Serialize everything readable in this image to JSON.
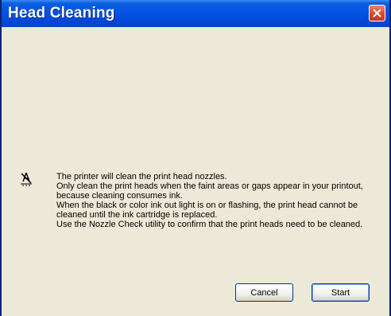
{
  "window": {
    "title": "Head Cleaning"
  },
  "message": {
    "icon": "head-cleaning-icon",
    "lines": [
      "The printer will clean the print head nozzles.",
      "Only clean the print heads when the faint areas or gaps appear in your printout, because cleaning consumes ink.",
      "When the black or color ink out light is on or flashing, the print head cannot be cleaned until the ink cartridge is replaced.",
      "Use the Nozzle Check utility to confirm that the print heads need to be cleaned."
    ]
  },
  "buttons": {
    "cancel": "Cancel",
    "start": "Start"
  },
  "colors": {
    "titlebar": "#0551e5",
    "close": "#d4472a",
    "face": "#ece9d8"
  }
}
